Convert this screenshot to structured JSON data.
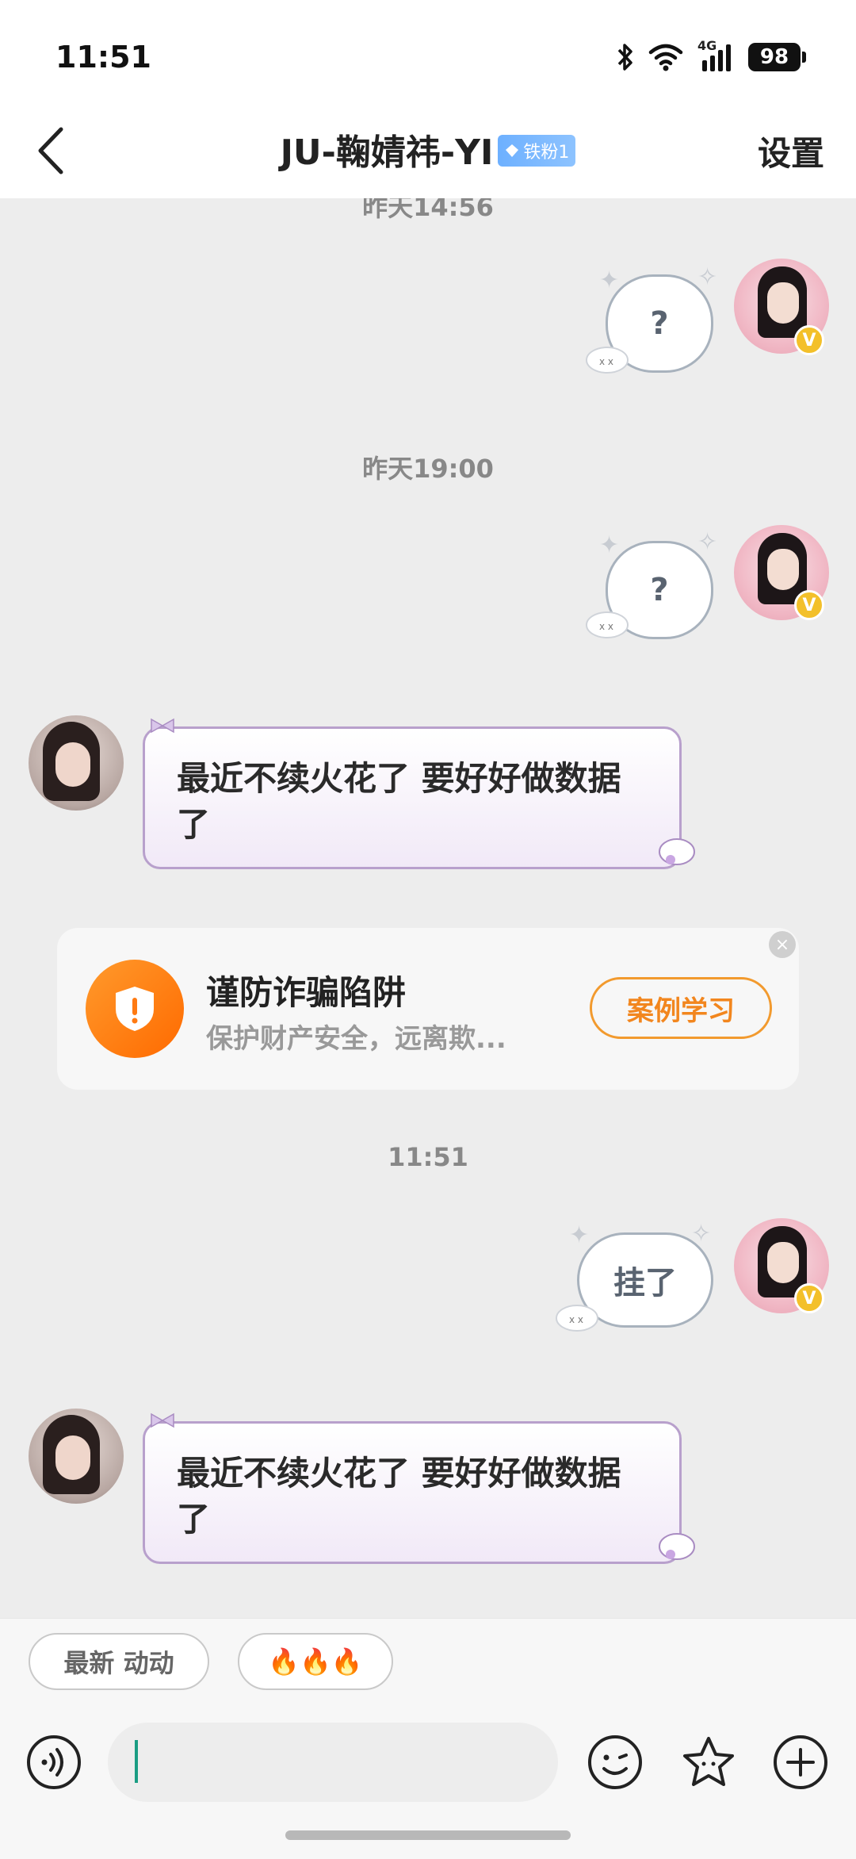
{
  "status_bar": {
    "time": "11:51",
    "network": "4G",
    "battery": "98"
  },
  "header": {
    "title": "JU-鞠婧祎-YI",
    "fan_badge": "铁粉1",
    "settings_label": "设置"
  },
  "chat": {
    "timestamps": [
      "昨天14:56",
      "昨天19:00",
      "11:51"
    ],
    "messages": [
      {
        "from": "me",
        "text": "?"
      },
      {
        "from": "me",
        "text": "?"
      },
      {
        "from": "them",
        "text": "最近不续火花了 要好好做数据了"
      },
      {
        "from": "me",
        "text": "挂了"
      },
      {
        "from": "them",
        "text": "最近不续火花了 要好好做数据了"
      }
    ],
    "verified_badge": "V"
  },
  "fraud_card": {
    "title": "谨防诈骗陷阱",
    "subtitle": "保护财产安全，远离欺...",
    "button_label": "案例学习",
    "close_label": "×"
  },
  "quick_replies": [
    "最新 动动",
    "🔥🔥🔥"
  ],
  "input": {
    "placeholder": ""
  },
  "colors": {
    "accent_orange": "#ff7a12",
    "bubble_border_purple": "#b8a0cc",
    "badge_blue": "#6db0ff",
    "caret_green": "#1a9d83"
  },
  "icons": [
    "back-arrow-icon",
    "voice-icon",
    "emoji-icon",
    "sticker-star-icon",
    "add-icon",
    "shield-icon",
    "bluetooth-icon",
    "wifi-icon",
    "signal-icon"
  ]
}
